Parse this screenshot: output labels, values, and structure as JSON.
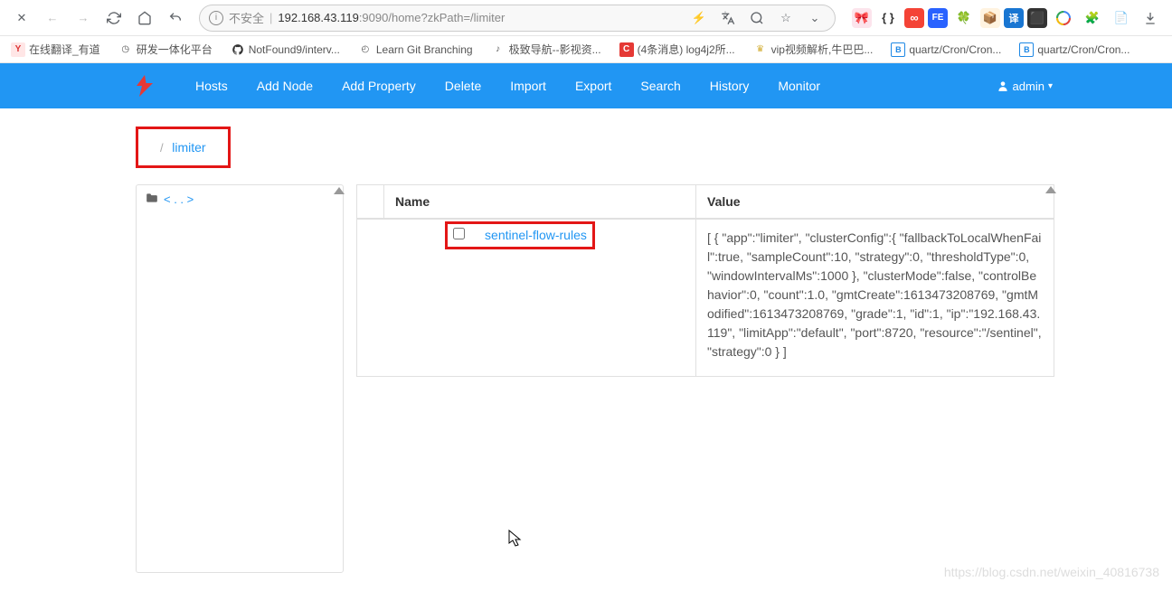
{
  "chrome": {
    "insecure_label": "不安全",
    "url_host": "192.168.43.119",
    "url_port": ":9090",
    "url_path": "/home?zkPath=/limiter"
  },
  "bookmarks": [
    {
      "icon_bg": "#ffe6e6",
      "icon_color": "#d33",
      "icon": "Y",
      "label": "在线翻译_有道"
    },
    {
      "icon_bg": "#fff",
      "icon_color": "#555",
      "icon": "◷",
      "label": "研发一体化平台"
    },
    {
      "icon_bg": "#fff",
      "icon_color": "#000",
      "icon": "○",
      "label": "NotFound9/interv..."
    },
    {
      "icon_bg": "#fff",
      "icon_color": "#555",
      "icon": "◴",
      "label": "Learn Git Branching"
    },
    {
      "icon_bg": "#fff",
      "icon_color": "#555",
      "icon": "♪",
      "label": "极致导航--影视资..."
    },
    {
      "icon_bg": "#e53935",
      "icon_color": "#fff",
      "icon": "C",
      "label": "(4条消息) log4j2所..."
    },
    {
      "icon_bg": "#fff",
      "icon_color": "#d4af37",
      "icon": "♛",
      "label": "vip视频解析,牛巴巴..."
    },
    {
      "icon_bg": "#fff",
      "icon_color": "#1e88e5",
      "icon": "B",
      "label": "quartz/Cron/Cron..."
    },
    {
      "icon_bg": "#fff",
      "icon_color": "#1e88e5",
      "icon": "B",
      "label": "quartz/Cron/Cron..."
    }
  ],
  "nav": {
    "items": [
      "Hosts",
      "Add Node",
      "Add Property",
      "Delete",
      "Import",
      "Export",
      "Search",
      "History",
      "Monitor"
    ],
    "user": "admin"
  },
  "breadcrumb": {
    "label": "limiter"
  },
  "tree": {
    "parent_label": "< . . >"
  },
  "table": {
    "col_name": "Name",
    "col_value": "Value",
    "rows": [
      {
        "name": "sentinel-flow-rules",
        "value": "[ { \"app\":\"limiter\", \"clusterConfig\":{ \"fallbackToLocalWhenFail\":true, \"sampleCount\":10, \"strategy\":0, \"thresholdType\":0, \"windowIntervalMs\":1000 }, \"clusterMode\":false, \"controlBehavior\":0, \"count\":1.0, \"gmtCreate\":1613473208769, \"gmtModified\":1613473208769, \"grade\":1, \"id\":1, \"ip\":\"192.168.43.119\", \"limitApp\":\"default\", \"port\":8720, \"resource\":\"/sentinel\", \"strategy\":0 } ]"
      }
    ]
  },
  "watermark": "https://blog.csdn.net/weixin_40816738"
}
